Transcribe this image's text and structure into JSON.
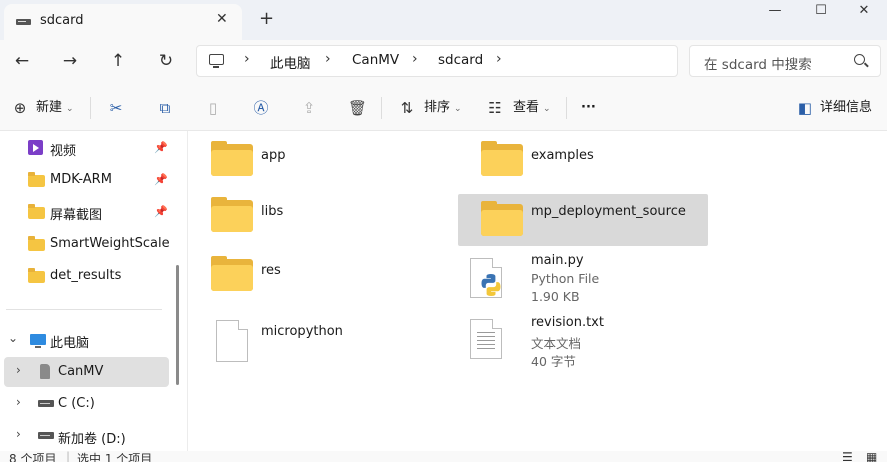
{
  "tab": {
    "title": "sdcard",
    "close_glyph": "✕",
    "new_tab_glyph": "+"
  },
  "window_controls": {
    "minimize": "—",
    "maximize": "☐",
    "close": "✕"
  },
  "nav": {
    "back": "←",
    "forward": "→",
    "up": "↑",
    "refresh": "↻"
  },
  "breadcrumb": {
    "items": [
      "此电脑",
      "CanMV",
      "sdcard"
    ],
    "separator": "›"
  },
  "search": {
    "placeholder": "在 sdcard 中搜索"
  },
  "toolbar": {
    "new_label": "新建",
    "sort_label": "排序",
    "view_label": "查看",
    "more_label": "···",
    "details_label": "详细信息"
  },
  "sidebar": {
    "quick": [
      {
        "label": "视频",
        "icon": "video-icon",
        "pinned": true
      },
      {
        "label": "MDK-ARM",
        "icon": "folder-icon",
        "pinned": true
      },
      {
        "label": "屏幕截图",
        "icon": "folder-icon",
        "pinned": true
      },
      {
        "label": "SmartWeightScale",
        "icon": "folder-icon",
        "pinned": false
      },
      {
        "label": "det_results",
        "icon": "folder-icon",
        "pinned": false
      }
    ],
    "this_pc": {
      "label": "此电脑",
      "icon": "monitor-icon"
    },
    "drives": [
      {
        "label": "CanMV",
        "icon": "sd-card-icon",
        "selected": true
      },
      {
        "label": "C (C:)",
        "icon": "disk-icon",
        "selected": false
      },
      {
        "label": "新加卷 (D:)",
        "icon": "disk-icon",
        "selected": false
      }
    ]
  },
  "files": [
    {
      "name": "app",
      "type": "folder"
    },
    {
      "name": "examples",
      "type": "folder"
    },
    {
      "name": "libs",
      "type": "folder"
    },
    {
      "name": "mp_deployment_source",
      "type": "folder",
      "selected": true
    },
    {
      "name": "res",
      "type": "folder"
    },
    {
      "name": "main.py",
      "type": "python",
      "kind": "Python File",
      "size": "1.90 KB"
    },
    {
      "name": "micropython",
      "type": "file"
    },
    {
      "name": "revision.txt",
      "type": "text",
      "kind": "文本文档",
      "size": "40 字节"
    }
  ],
  "status": {
    "count": "8 个项目",
    "selected": "选中 1 个项目"
  },
  "colors": {
    "folder": "#fcd15a",
    "accent": "#2b5fa8",
    "selected": "#d9d9d9"
  }
}
